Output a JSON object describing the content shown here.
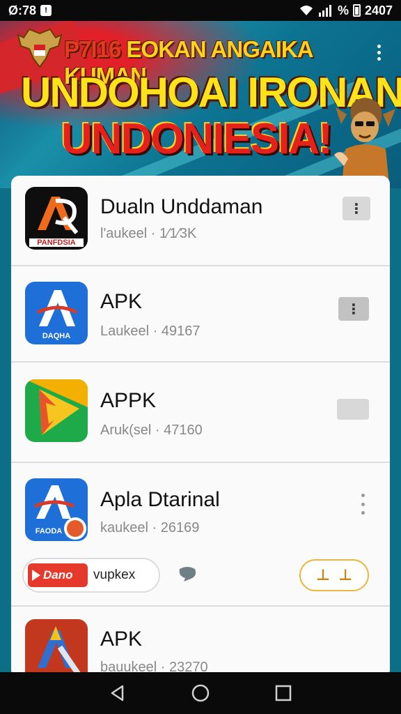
{
  "status_bar": {
    "time": "Ø:78",
    "notif_glyph": "!",
    "battery_pct": "%",
    "clock_right": "2407",
    "icons": [
      "wifi-icon",
      "signal-icon",
      "battery-icon"
    ]
  },
  "banner": {
    "line1_red": "P7I16",
    "line1_yellow": "EOKAN ANGAIKA KUMAN",
    "line2": "UNDOHOAI IRONAN",
    "line3": "UNDONIESIA!"
  },
  "apps": [
    {
      "name": "Dualn Unddaman",
      "meta": "l'aukeel · 1⁄1⁄3K",
      "icon_label": "PANFDSIA",
      "icon": "app-icon-red-a",
      "action": "gray-button"
    },
    {
      "name": "APK",
      "meta": "Laukeel · 49167",
      "icon_label": "DAQHA",
      "icon": "app-icon-blue-a",
      "action": "gray-button"
    },
    {
      "name": "APPK",
      "meta": "Aruk(sel · 47160",
      "icon_label": "",
      "icon": "app-icon-play",
      "action": "gray-button"
    },
    {
      "name": "Apla Dtarinal",
      "meta": "kaukeel · 26169",
      "icon_label": "FAODA",
      "icon": "app-icon-blue-a2",
      "action": "more"
    },
    {
      "name": "APK",
      "meta": "bauukeel · 23270",
      "icon_label": "",
      "icon": "app-icon-wrench-a",
      "action": "none"
    }
  ],
  "row4_extras": {
    "badge_text": "Dano",
    "pill_text": "vupkex",
    "right_pill_glyphs": [
      "⊥",
      "⊥"
    ]
  },
  "colors": {
    "banner_yellow": "#ffd21e",
    "banner_red": "#e5211b",
    "accent_gold": "#e9b73f"
  }
}
